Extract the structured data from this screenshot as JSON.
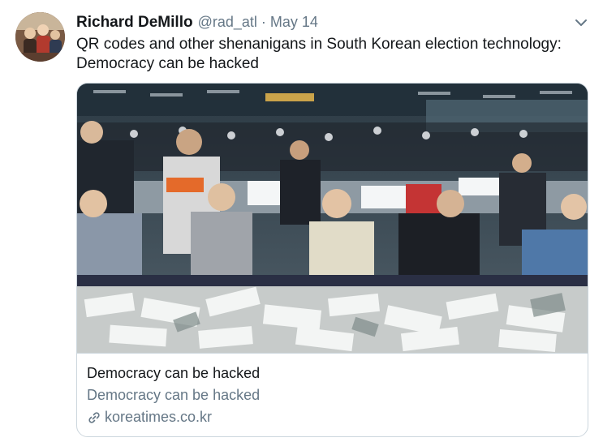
{
  "tweet": {
    "author_name": "Richard DeMillo",
    "handle": "@rad_atl",
    "separator": "·",
    "date": "May 14",
    "text": "QR codes and other shenanigans in South Korean election technology: Democracy can be hacked"
  },
  "card": {
    "title": "Democracy can be hacked",
    "description": "Democracy can be hacked",
    "domain": "koreatimes.co.kr"
  },
  "icons": {
    "menu": "chevron-down-icon",
    "link": "link-icon"
  },
  "colors": {
    "name": "#14171a",
    "secondary": "#657786",
    "border": "#ccd6dd"
  }
}
